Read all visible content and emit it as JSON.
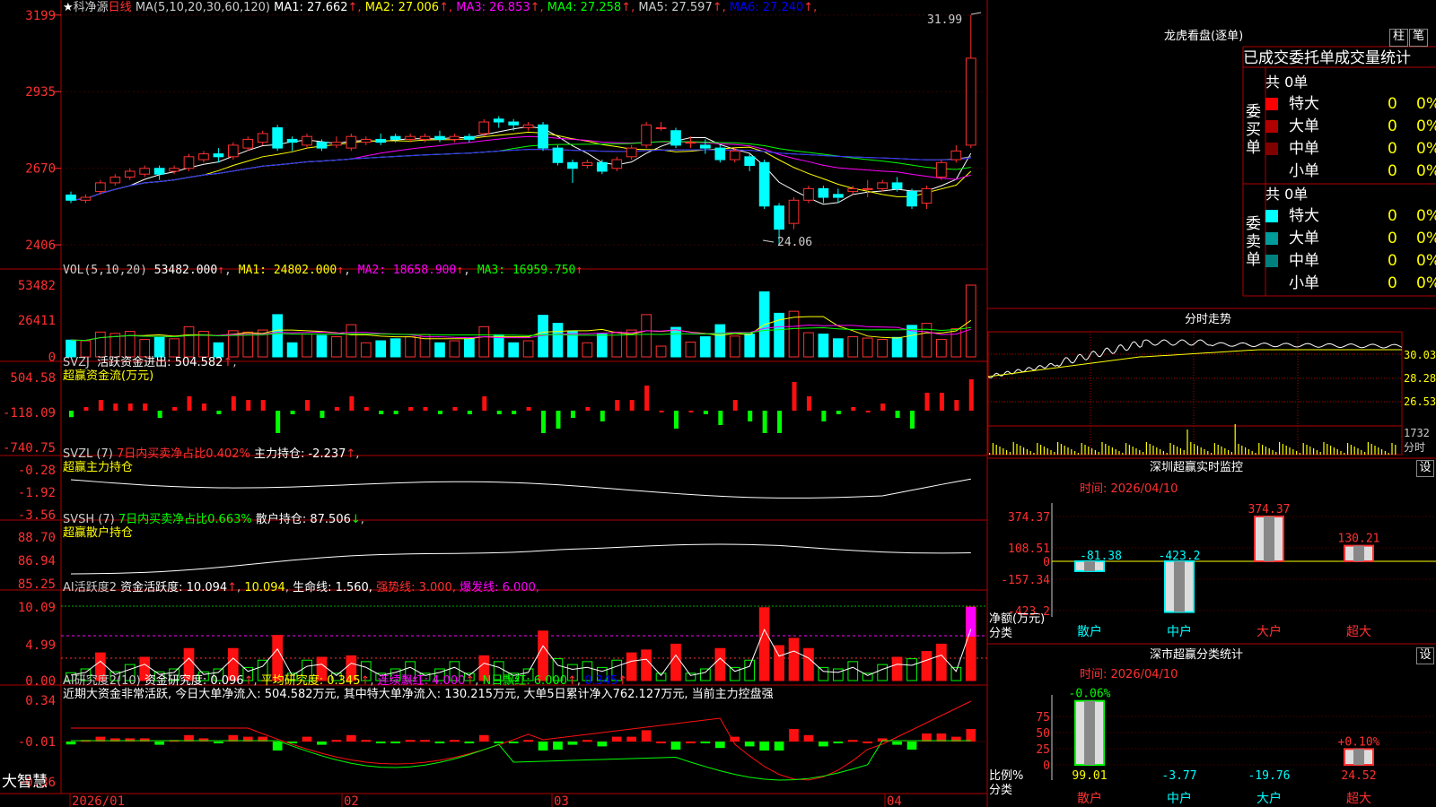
{
  "header": {
    "star": "★",
    "stock_name": "科净源",
    "period": "日线",
    "ma_label": "MA(5,10,20,30,60,120)",
    "ma_values": [
      {
        "name": "MA1:",
        "value": "27.662",
        "arrow": "↑",
        "color": "#ffffff"
      },
      {
        "name": "MA2:",
        "value": "27.006",
        "arrow": "↑",
        "color": "#ffff00"
      },
      {
        "name": "MA3:",
        "value": "26.853",
        "arrow": "↑",
        "color": "#ff00ff"
      },
      {
        "name": "MA4:",
        "value": "27.258",
        "arrow": "↑",
        "color": "#00ff00"
      },
      {
        "name": "MA5:",
        "value": "27.597",
        "arrow": "↑",
        "color": "#cccccc"
      },
      {
        "name": "MA6:",
        "value": "27.240",
        "arrow": "↑",
        "color": "#0000ff"
      }
    ]
  },
  "price_axis": [
    "3199",
    "2935",
    "2670",
    "2406"
  ],
  "annotations": {
    "high": "31.99",
    "low": "24.06"
  },
  "vol": {
    "label": "VOL(5,10,20)",
    "value": "53482.000",
    "ma1": "MA1: 24802.000",
    "ma2": "MA2: 18658.900",
    "ma3": "MA3: 16959.750",
    "axis": [
      "53482",
      "26411",
      "0"
    ]
  },
  "svzj": {
    "line1_name": "SVZJ",
    "line1_label": "活跃资金进出:",
    "line1_value": "504.582",
    "line2_label": "超赢资金流(万元)",
    "axis": [
      "504.58",
      "-118.09",
      "-740.75"
    ]
  },
  "svzl": {
    "name": "SVZL (7)",
    "ratio": "7日内买卖净占比0.402%",
    "hold": "主力持仓: -2.237",
    "line2": "超赢主力持仓",
    "axis": [
      "-0.28",
      "-1.92",
      "-3.56"
    ]
  },
  "svsh": {
    "name": "SVSH (7)",
    "ratio": "7日内买卖净占比0.663%",
    "hold": "散户持仓: 87.506",
    "line2": "超赢散户持仓",
    "axis": [
      "88.70",
      "86.94",
      "85.25"
    ]
  },
  "ai1": {
    "name": "AI活跃度2",
    "label": "资金活跃度: 10.094",
    "v2": "10.094",
    "life": "生命线: 1.560,",
    "strong": "强势线: 3.000,",
    "burst": "爆发线: 6.000,",
    "axis": [
      "10.09",
      "4.99",
      "0.00"
    ]
  },
  "ai2": {
    "name": "AI研究度2(10)",
    "label": "资金研究度: 0.096",
    "avg": "平均研究度: 0.345",
    "red": "连续飘红: 4.000",
    "nred": "N日飘红: 6.000",
    "v5": "0.345",
    "summary": "近期大资金非常活跃, 今日大单净流入: 504.582万元, 其中特大单净流入: 130.215万元, 大单5日累计净入762.127万元, 当前主力控盘强",
    "axis": [
      "0.34",
      "-0.01",
      "-0.36"
    ]
  },
  "dates": [
    "2026/01",
    "02",
    "03",
    "04"
  ],
  "bottom_left": "大智慧",
  "right": {
    "title": "龙虎看盘(逐单)",
    "btn_bar": "柱",
    "btn_pen": "笔",
    "tabs": [
      "已成交委托单成交量统计"
    ],
    "buy_side": "委买单",
    "sell_side": "委卖单",
    "buy_total": "共 0单",
    "sell_total": "共 0单",
    "buy_rows": [
      {
        "label": "特大",
        "v": "0",
        "p": "0%",
        "color": "#ff0000"
      },
      {
        "label": "大单",
        "v": "0",
        "p": "0%",
        "color": "#b00000"
      },
      {
        "label": "中单",
        "v": "0",
        "p": "0%",
        "color": "#800000"
      },
      {
        "label": "小单",
        "v": "0",
        "p": "0%",
        "color": ""
      }
    ],
    "sell_rows": [
      {
        "label": "特大",
        "v": "0",
        "p": "0%",
        "color": "#00ffff"
      },
      {
        "label": "大单",
        "v": "0",
        "p": "0%",
        "color": "#009b9b"
      },
      {
        "label": "中单",
        "v": "0",
        "p": "0%",
        "color": "#007f7f"
      },
      {
        "label": "小单",
        "v": "0",
        "p": "0%",
        "color": ""
      }
    ],
    "intraday_title": "分时走势",
    "intraday_axis": [
      "30.03",
      "28.28",
      "26.53"
    ],
    "intraday_vol": "1732",
    "intraday_vol_label": "分时",
    "monitor_title": "深圳超赢实时监控",
    "monitor_btn": "设",
    "monitor_time": "时间: 2026/04/10",
    "monitor_axis": [
      "374.37",
      "108.51",
      "0",
      "-157.34",
      "-423.2"
    ],
    "monitor_net_label": "净额(万元)",
    "monitor_cat_label": "分类",
    "monitor_bars": [
      {
        "cat": "散户",
        "value": -81.38,
        "label": "-81.38"
      },
      {
        "cat": "中户",
        "value": -423.2,
        "label": "-423.2"
      },
      {
        "cat": "大户",
        "value": 374.37,
        "label": "374.37"
      },
      {
        "cat": "超大",
        "value": 130.21,
        "label": "130.21"
      }
    ],
    "stat_title": "深市超赢分类统计",
    "stat_btn": "设",
    "stat_time": "时间: 2026/04/10",
    "stat_axis": [
      "75",
      "50",
      "25",
      "0"
    ],
    "stat_ratio_label": "比例%",
    "stat_cat_label": "分类",
    "stat_bars": [
      {
        "cat": "散户",
        "value": 99.01,
        "change": "-0.06%"
      },
      {
        "cat": "中户",
        "value": -3.77
      },
      {
        "cat": "大户",
        "value": -19.76
      },
      {
        "cat": "超大",
        "value": 24.52,
        "change": "+0.10%"
      }
    ]
  },
  "chart_data": [
    {
      "type": "candlestick",
      "title": "科净源 日线",
      "ohlc": [
        [
          25.78,
          25.6,
          25.9,
          25.5
        ],
        [
          25.6,
          25.7,
          25.8,
          25.5
        ],
        [
          25.9,
          26.2,
          26.3,
          25.8
        ],
        [
          26.2,
          26.4,
          26.5,
          26.1
        ],
        [
          26.4,
          26.6,
          26.7,
          26.3
        ],
        [
          26.5,
          26.7,
          26.8,
          26.4
        ],
        [
          26.7,
          26.5,
          26.8,
          26.3
        ],
        [
          26.6,
          26.7,
          26.8,
          26.5
        ],
        [
          26.7,
          27.1,
          27.2,
          26.6
        ],
        [
          27.0,
          27.2,
          27.3,
          26.9
        ],
        [
          27.2,
          27.1,
          27.4,
          26.9
        ],
        [
          27.1,
          27.5,
          27.6,
          27.0
        ],
        [
          27.4,
          27.7,
          27.8,
          27.3
        ],
        [
          27.6,
          27.9,
          28.0,
          27.5
        ],
        [
          28.1,
          27.4,
          28.2,
          27.3
        ],
        [
          27.7,
          27.6,
          27.8,
          27.3
        ],
        [
          27.5,
          27.8,
          27.9,
          27.4
        ],
        [
          27.6,
          27.4,
          27.7,
          27.3
        ],
        [
          27.5,
          27.6,
          27.8,
          27.4
        ],
        [
          27.4,
          27.8,
          27.9,
          27.3
        ],
        [
          27.6,
          27.7,
          27.8,
          27.5
        ],
        [
          27.7,
          27.6,
          27.9,
          27.5
        ],
        [
          27.8,
          27.7,
          27.9,
          27.6
        ],
        [
          27.7,
          27.8,
          27.9,
          27.6
        ],
        [
          27.7,
          27.8,
          27.9,
          27.6
        ],
        [
          27.8,
          27.7,
          28.0,
          27.6
        ],
        [
          27.7,
          27.8,
          27.9,
          27.6
        ],
        [
          27.8,
          27.7,
          27.9,
          27.6
        ],
        [
          27.9,
          28.3,
          28.4,
          27.8
        ],
        [
          28.4,
          28.3,
          28.5,
          28.1
        ],
        [
          28.3,
          28.2,
          28.4,
          28.0
        ],
        [
          28.1,
          28.2,
          28.3,
          28.0
        ],
        [
          28.2,
          27.4,
          28.3,
          27.3
        ],
        [
          27.4,
          26.9,
          27.5,
          26.8
        ],
        [
          26.9,
          26.7,
          27.0,
          26.2
        ],
        [
          26.8,
          26.9,
          27.0,
          26.7
        ],
        [
          26.9,
          26.6,
          27.0,
          26.5
        ],
        [
          26.7,
          27.0,
          27.1,
          26.6
        ],
        [
          27.1,
          27.4,
          27.5,
          27.0
        ],
        [
          27.5,
          28.2,
          28.3,
          27.4
        ],
        [
          28.1,
          28.1,
          28.3,
          28.0
        ],
        [
          28.0,
          27.5,
          28.1,
          27.4
        ],
        [
          27.6,
          27.6,
          27.8,
          27.4
        ],
        [
          27.5,
          27.4,
          27.7,
          27.2
        ],
        [
          27.4,
          27.0,
          27.5,
          26.9
        ],
        [
          27.0,
          27.3,
          27.4,
          26.9
        ],
        [
          27.1,
          26.8,
          27.2,
          26.6
        ],
        [
          26.9,
          25.4,
          27.0,
          25.3
        ],
        [
          25.4,
          24.6,
          25.5,
          24.06
        ],
        [
          24.8,
          25.6,
          25.7,
          24.6
        ],
        [
          25.6,
          26.0,
          26.1,
          25.5
        ],
        [
          26.0,
          25.7,
          26.1,
          25.5
        ],
        [
          25.8,
          25.7,
          26.0,
          25.5
        ],
        [
          25.9,
          26.0,
          26.1,
          25.8
        ],
        [
          26.0,
          26.0,
          26.3,
          25.7
        ],
        [
          26.0,
          26.2,
          26.3,
          25.9
        ],
        [
          26.2,
          26.0,
          26.4,
          25.9
        ],
        [
          25.9,
          25.4,
          26.0,
          25.3
        ],
        [
          25.5,
          26.0,
          26.1,
          25.3
        ],
        [
          26.4,
          26.9,
          27.0,
          26.3
        ],
        [
          27.0,
          27.3,
          27.5,
          26.9
        ],
        [
          27.5,
          30.5,
          31.99,
          27.4
        ]
      ],
      "ylim": [
        24.0,
        32.2
      ]
    }
  ]
}
